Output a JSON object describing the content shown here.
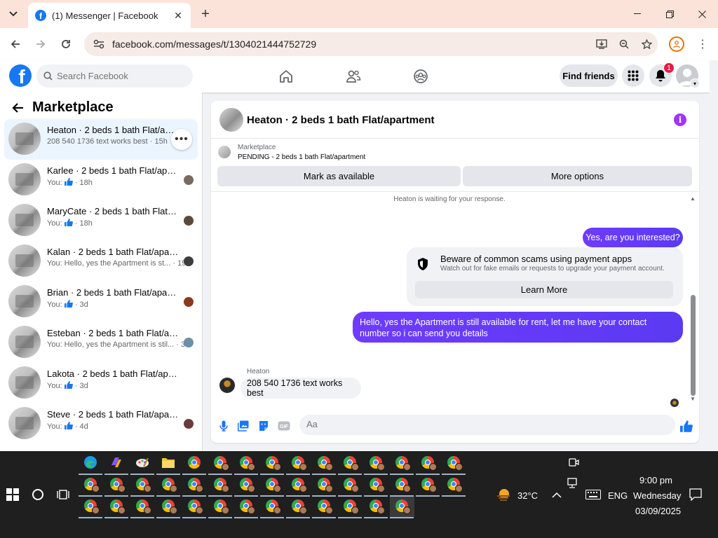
{
  "browser": {
    "tab_title": "(1) Messenger | Facebook",
    "url": "facebook.com/messages/t/1304021444752729"
  },
  "fb": {
    "search_placeholder": "Search Facebook",
    "find_friends": "Find friends",
    "notification_count": "1"
  },
  "sidebar": {
    "title": "Marketplace",
    "conversations": [
      {
        "name": "Heaton · 2 beds 1 bath Flat/apartment",
        "snippet": "208 540 1736 text works best · 15h",
        "active": true
      },
      {
        "name": "Karlee · 2 beds 1 bath Flat/apart...",
        "snippet_prefix": "You: ",
        "snippet_suffix": " · 18h"
      },
      {
        "name": "MaryCate · 2 beds 1 bath Flat/ap...",
        "snippet_prefix": "You: ",
        "snippet_suffix": " · 18h"
      },
      {
        "name": "Kalan · 2 beds 1 bath Flat/apart...",
        "snippet": "You: Hello, yes the Apartment is st... · 19h"
      },
      {
        "name": "Brian · 2 beds 1 bath Flat/apart...",
        "snippet_prefix": "You: ",
        "snippet_suffix": " · 3d"
      },
      {
        "name": "Esteban · 2 beds 1 bath Flat/apa...",
        "snippet": "You: Hello, yes the Apartment is stil... · 3d"
      },
      {
        "name": "Lakota · 2 beds 1 bath Flat/apartm...",
        "snippet_prefix": "You: ",
        "snippet_suffix": " · 3d"
      },
      {
        "name": "Steve · 2 beds 1 bath Flat/apart...",
        "snippet_prefix": "You: ",
        "snippet_suffix": " · 4d"
      }
    ]
  },
  "chat": {
    "title": "Heaton · 2 beds 1 bath Flat/apartment",
    "marketplace_label": "Marketplace",
    "status": "PENDING - 2 beds 1 bath Flat/apartment",
    "mark_available": "Mark as available",
    "more_options": "More options",
    "waiting": "Heaton is waiting for your response.",
    "out_msg_1": "Yes, are you interested?",
    "notice_title": "Beware of common scams using payment apps",
    "notice_body": "Watch out for fake emails or requests to upgrade your payment account.",
    "learn_more": "Learn More",
    "out_msg_2": "Hello, yes the Apartment is still available for rent, let me have your contact number so i can send you details",
    "in_name": "Heaton",
    "in_msg": "208 540 1736 text works best",
    "composer_placeholder": "Aa"
  },
  "taskbar": {
    "weather": "32°C",
    "lang": "ENG",
    "time": "9:00 pm",
    "day": "Wednesday",
    "date": "03/09/2025"
  },
  "colors": {
    "fb_blue": "#1877f2",
    "outgoing_bubble": "#6e3bff",
    "badge_red": "#e41e3f"
  }
}
